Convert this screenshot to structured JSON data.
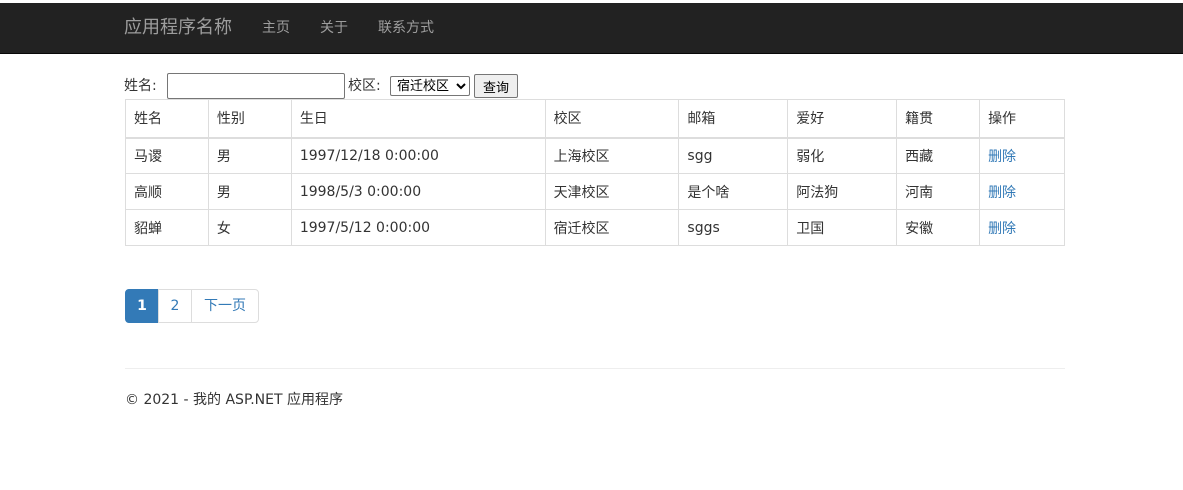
{
  "navbar": {
    "brand": "应用程序名称",
    "items": [
      "主页",
      "关于",
      "联系方式"
    ]
  },
  "search": {
    "name_label": "姓名:",
    "name_value": "",
    "campus_label": "校区:",
    "campus_selected": "宿迁校区",
    "query_label": "查询"
  },
  "table": {
    "headers": [
      "姓名",
      "性别",
      "生日",
      "校区",
      "邮箱",
      "爱好",
      "籍贯",
      "操作"
    ],
    "rows": [
      [
        "马谡",
        "男",
        "1997/12/18 0:00:00",
        "上海校区",
        "sgg",
        "弱化",
        "西藏",
        "删除"
      ],
      [
        "高顺",
        "男",
        "1998/5/3 0:00:00",
        "天津校区",
        "是个啥",
        "阿法狗",
        "河南",
        "删除"
      ],
      [
        "貂蝉",
        "女",
        "1997/5/12 0:00:00",
        "宿迁校区",
        "sggs",
        "卫国",
        "安徽",
        "删除"
      ]
    ]
  },
  "pagination": {
    "pages": [
      "1",
      "2"
    ],
    "current": "1",
    "next_label": "下一页"
  },
  "footer": {
    "text": "© 2021 - 我的 ASP.NET 应用程序"
  },
  "colors": {
    "navbar_bg": "#222222",
    "navbar_text": "#9d9d9d",
    "link": "#337ab7",
    "active_page": "#337ab7"
  }
}
